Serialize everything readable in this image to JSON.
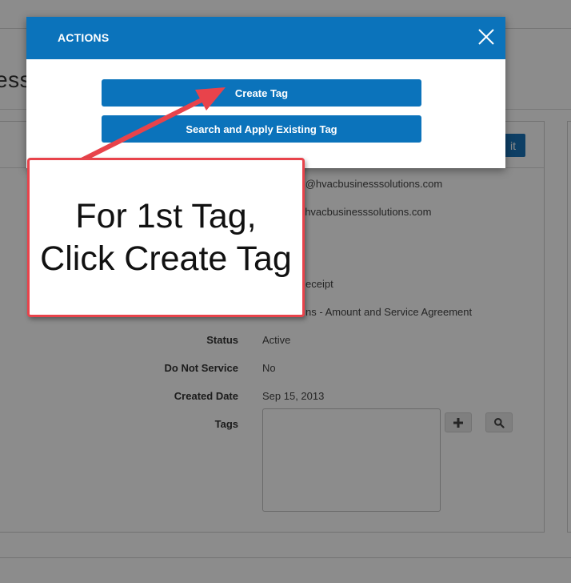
{
  "page": {
    "title_fragment": "ess",
    "edit_label_fragment": "it"
  },
  "details": {
    "email_1_fragment": "ith@hvacbusinesssolutions.com",
    "email_2_fragment": "@hvacbusinesssolutions.com",
    "receipt_fragment": "eceipt",
    "terms_fragment": "ns - Amount and Service Agreement",
    "fields": [
      {
        "label": "Status",
        "value": "Active"
      },
      {
        "label": "Do Not Service",
        "value": "No"
      },
      {
        "label": "Created Date",
        "value": "Sep 15, 2013"
      },
      {
        "label": "Tags",
        "value": ""
      }
    ],
    "tag_tools": {
      "add_icon": "plus-icon",
      "search_icon": "magnifier-icon"
    }
  },
  "modal": {
    "title": "ACTIONS",
    "close_icon": "close-x-icon",
    "buttons": {
      "create_tag": "Create Tag",
      "search_existing": "Search and Apply Existing Tag"
    }
  },
  "annotation": {
    "callout_text": "For 1st Tag, Click Create Tag",
    "color": "#e8434b"
  },
  "colors": {
    "primary": "#0b73bb",
    "overlay": "rgba(0,0,0,0.45)"
  }
}
